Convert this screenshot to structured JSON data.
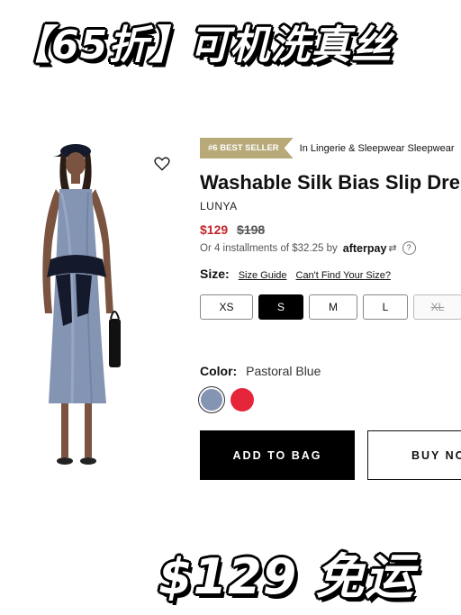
{
  "promo": {
    "top_text": "【65折】可机洗真丝",
    "bottom_text": "$129 免运"
  },
  "product": {
    "badge": "#6 BEST SELLER",
    "category": "In Lingerie & Sleepwear Sleepwear",
    "title": "Washable Silk Bias Slip Dress",
    "brand": "LUNYA",
    "price_sale": "$129",
    "price_original": "$198",
    "installments_text": "Or 4 installments of $32.25 by",
    "afterpay_label": "afterpay",
    "help_symbol": "?"
  },
  "size": {
    "label": "Size:",
    "guide_link": "Size Guide",
    "cant_find_link": "Can't Find Your Size?",
    "options": [
      {
        "label": "XS",
        "state": "available"
      },
      {
        "label": "S",
        "state": "selected"
      },
      {
        "label": "M",
        "state": "available"
      },
      {
        "label": "L",
        "state": "available"
      },
      {
        "label": "XL",
        "state": "unavailable"
      }
    ]
  },
  "color": {
    "label": "Color:",
    "selected_name": "Pastoral Blue",
    "swatches": [
      {
        "name": "Pastoral Blue",
        "hex": "#8494b3",
        "selected": true
      },
      {
        "name": "Red",
        "hex": "#e5263a",
        "selected": false
      }
    ]
  },
  "actions": {
    "add_to_bag": "ADD TO BAG",
    "buy_now": "BUY NOW"
  },
  "icons": {
    "wishlist": "heart-outline-icon",
    "afterpay": "afterpay-arrows-icon",
    "help": "help-circle-icon"
  },
  "colors": {
    "badge_bg": "#b8a978",
    "sale_price": "#c0272d",
    "primary_button": "#000000"
  }
}
